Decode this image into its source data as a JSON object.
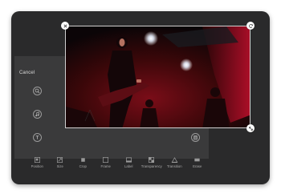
{
  "header": {
    "cancel_label": "Cancel"
  },
  "side_tools": [
    {
      "name": "adjust",
      "icon": "zoom-icon"
    },
    {
      "name": "music",
      "icon": "music-note-icon"
    },
    {
      "name": "subtitle",
      "icon": "text-icon"
    }
  ],
  "toolbar": {
    "items": [
      {
        "label": "Position",
        "icon": "position-icon"
      },
      {
        "label": "Size",
        "icon": "size-icon"
      },
      {
        "label": "Crop",
        "icon": "crop-icon"
      },
      {
        "label": "Frame",
        "icon": "frame-icon"
      },
      {
        "label": "Label",
        "icon": "label-icon"
      },
      {
        "label": "Transparency",
        "icon": "transparency-icon"
      },
      {
        "label": "Transition",
        "icon": "transition-icon"
      },
      {
        "label": "Erase",
        "icon": "erase-icon"
      }
    ]
  },
  "photo": {
    "subject": "concert-stage-photo"
  },
  "colors": {
    "device": "#2a2a2b",
    "panel": "#3a3a3b",
    "stage_red": "#c8102e",
    "handle": "#ffffff"
  }
}
